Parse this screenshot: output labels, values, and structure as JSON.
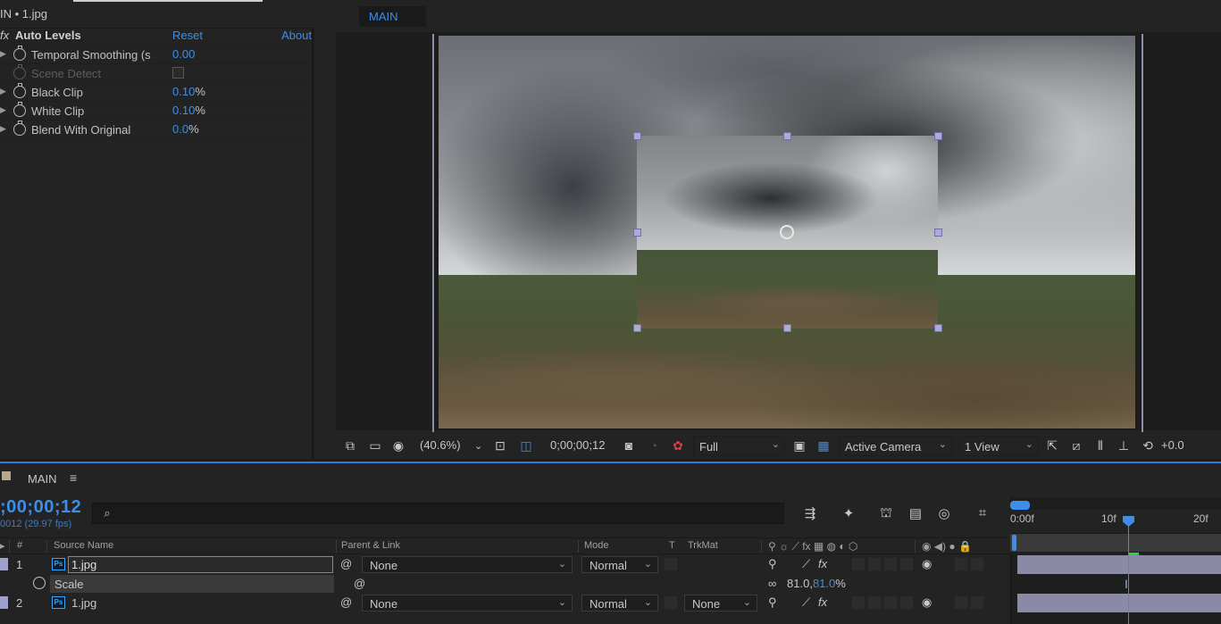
{
  "effects_panel": {
    "tab_title": "IN • 1.jpg",
    "effect_name": "Auto Levels",
    "reset_label": "Reset",
    "about_label": "About",
    "properties": [
      {
        "label": "Temporal Smoothing (s",
        "value": "0.00",
        "unit": ""
      },
      {
        "label": "Scene Detect",
        "value": "",
        "unit": ""
      },
      {
        "label": "Black Clip",
        "value": "0.10",
        "unit": "%"
      },
      {
        "label": "White Clip",
        "value": "0.10",
        "unit": "%"
      },
      {
        "label": "Blend With Original",
        "value": "0.0",
        "unit": "%"
      }
    ]
  },
  "composition": {
    "tab_label": "MAIN",
    "toolbar": {
      "zoom": "(40.6%)",
      "timecode": "0;00;00;12",
      "resolution": "Full",
      "camera": "Active Camera",
      "views": "1 View",
      "exposure": "+0.0"
    }
  },
  "timeline": {
    "comp_name": "MAIN",
    "current_time": ";00;00;12",
    "fps_label": "0012 (29.97 fps)",
    "columns": {
      "num": "#",
      "source_name": "Source Name",
      "parent_link": "Parent & Link",
      "mode": "Mode",
      "t": "T",
      "trkmat": "TrkMat"
    },
    "layers": [
      {
        "num": "1",
        "name": "1.jpg",
        "parent": "None",
        "mode": "Normal",
        "trkmat": ""
      },
      {
        "num": "2",
        "name": "1.jpg",
        "parent": "None",
        "mode": "Normal",
        "trkmat": "None"
      }
    ],
    "scale_property": {
      "label": "Scale",
      "value_x": "81.0",
      "value_y": "81.0",
      "unit": "%"
    },
    "ruler": {
      "start": "0:00f",
      "mid": "10f",
      "end": "20f"
    }
  },
  "colors": {
    "accent_blue": "#3d8ee8",
    "panel_bg": "#232323",
    "layer_bar": "#8a8aa6",
    "comp_swatch": "#b5a88c"
  }
}
